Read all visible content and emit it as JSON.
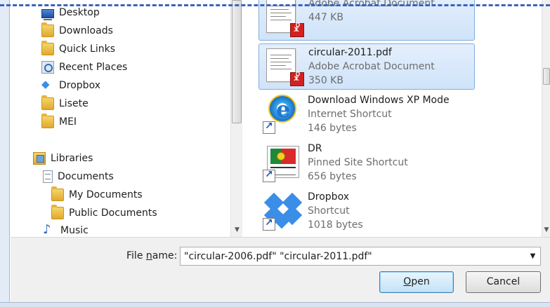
{
  "nav": {
    "items": [
      {
        "label": "Desktop",
        "icon": "desktop-icon"
      },
      {
        "label": "Downloads",
        "icon": "downloads-folder-icon"
      },
      {
        "label": "Quick Links",
        "icon": "quick-links-folder-icon"
      },
      {
        "label": "Recent Places",
        "icon": "recent-places-icon"
      },
      {
        "label": "Dropbox",
        "icon": "dropbox-icon"
      },
      {
        "label": "Lisete",
        "icon": "user-folder-icon"
      },
      {
        "label": "MEI",
        "icon": "folder-icon"
      },
      {
        "label": "Libraries",
        "icon": "libraries-icon"
      },
      {
        "label": "Documents",
        "icon": "documents-icon"
      },
      {
        "label": "My Documents",
        "icon": "folder-icon"
      },
      {
        "label": "Public Documents",
        "icon": "folder-icon"
      },
      {
        "label": "Music",
        "icon": "music-icon"
      }
    ]
  },
  "files": [
    {
      "name": "",
      "type": "Adobe Acrobat Document",
      "size": "447 KB",
      "selected": true,
      "icon": "pdf-icon"
    },
    {
      "name": "circular-2011.pdf",
      "type": "Adobe Acrobat Document",
      "size": "350 KB",
      "selected": true,
      "icon": "pdf-icon"
    },
    {
      "name": "Download Windows XP Mode",
      "type": "Internet Shortcut",
      "size": "146 bytes",
      "selected": false,
      "icon": "internet-explorer-icon"
    },
    {
      "name": "DR",
      "type": "Pinned Site Shortcut",
      "size": "656 bytes",
      "selected": false,
      "icon": "portugal-flag-icon"
    },
    {
      "name": "Dropbox",
      "type": "Shortcut",
      "size": "1018 bytes",
      "selected": false,
      "icon": "dropbox-icon"
    }
  ],
  "bottom": {
    "filename_label_pre": "File ",
    "filename_label_mnemonic": "n",
    "filename_label_post": "ame:",
    "filename_value": "\"circular-2006.pdf\" \"circular-2011.pdf\"",
    "open_mnemonic": "O",
    "open_rest": "pen",
    "cancel_label": "Cancel"
  },
  "colors": {
    "selection_bg": "#cfe3fa",
    "selection_border": "#84acdd",
    "dash_border": "#3b64b8",
    "open_button_border": "#3c7fb1"
  }
}
